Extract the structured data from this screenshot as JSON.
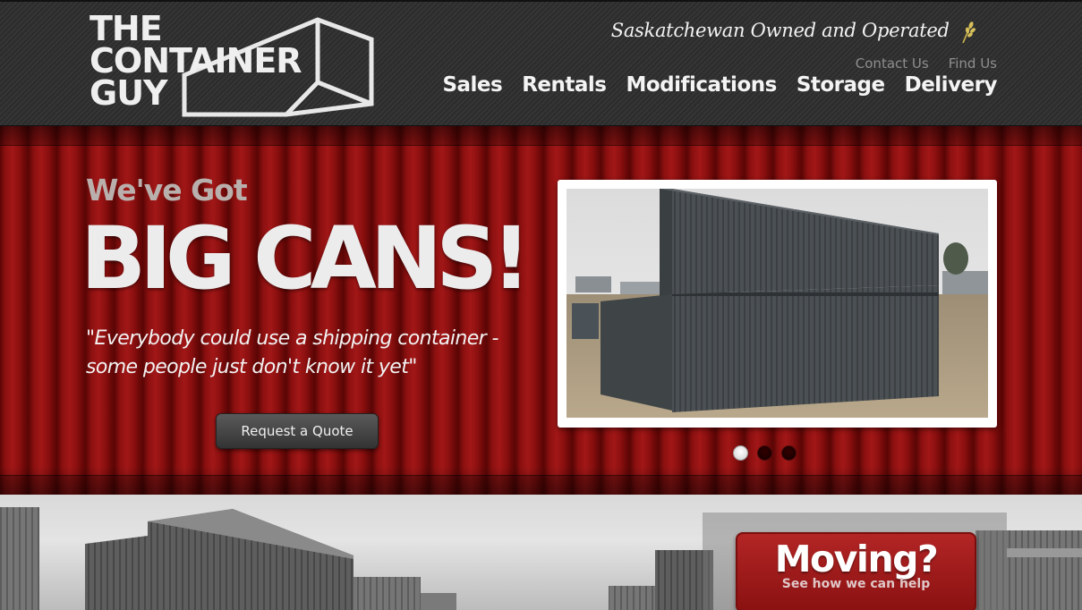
{
  "brand": {
    "logo_line1": "THE",
    "logo_line2": "CONTAINER",
    "logo_line3": "GUY",
    "tagline": "Saskatchewan Owned and Operated"
  },
  "utility_nav": [
    {
      "label": "Contact Us"
    },
    {
      "label": "Find Us"
    }
  ],
  "main_nav": [
    {
      "label": "Sales"
    },
    {
      "label": "Rentals"
    },
    {
      "label": "Modifications"
    },
    {
      "label": "Storage"
    },
    {
      "label": "Delivery"
    }
  ],
  "hero": {
    "kicker": "We've Got",
    "headline": "BIG CANS!",
    "quote_line1": "\"Everybody could use a shipping container -",
    "quote_line2": "some people just don't know it yet\"",
    "cta_label": "Request a Quote",
    "slides_total": 3,
    "active_slide": 1
  },
  "promo": {
    "title": "Moving?",
    "subtitle": "See how we can help"
  },
  "colors": {
    "header_bg": "#2e2e2e",
    "hero_red": "#8c1010",
    "promo_red": "#b32525"
  }
}
